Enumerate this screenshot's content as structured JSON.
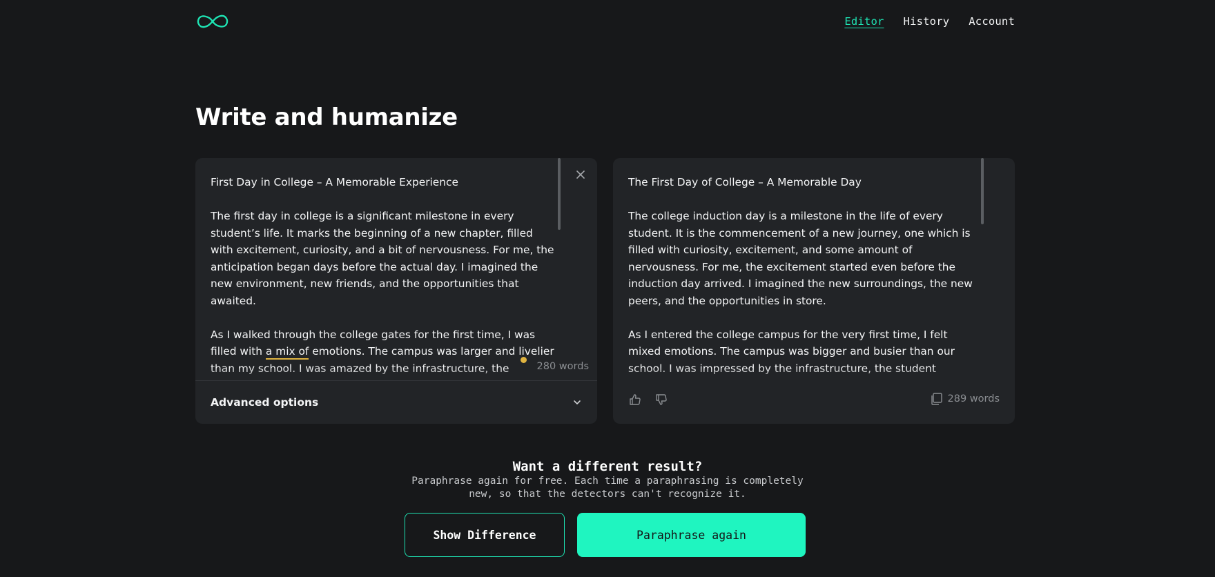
{
  "header": {
    "logo_icon": "infinity-logo-icon",
    "nav": [
      {
        "label": "Editor",
        "active": true
      },
      {
        "label": "History",
        "active": false
      },
      {
        "label": "Account",
        "active": false
      }
    ]
  },
  "page_title": "Write and humanize",
  "input_panel": {
    "heading": "First Day in College – A Memorable Experience",
    "paragraph1": "The first day in college is a significant milestone in every student’s life. It marks the beginning of a new chapter, filled with excitement, curiosity, and a bit of nervousness. For me, the anticipation began days before the actual day. I imagined the new environment, new friends, and the opportunities that awaited.",
    "paragraph2_before": "As I walked through the college gates for the first time, I was filled with ",
    "paragraph2_highlight": "a mix of",
    "paragraph2_after": " emotions. The campus was larger and livelier than my school. I was amazed by the infrastructure, the",
    "word_count": "280 words",
    "advanced_label": "Advanced options"
  },
  "output_panel": {
    "heading": "The First Day of College – A Memorable Day",
    "paragraph1": "The college induction day is a milestone in the life of every student. It is the commencement of a new journey, one which is filled with curiosity, excitement, and some amount of nervousness. For me, the excitement started even before the induction day arrived. I imagined the new surroundings, the new peers, and the opportunities in store.",
    "paragraph2": "As I entered the college campus for the very first time, I felt mixed emotions. The campus was bigger and busier than our school. I was impressed by the infrastructure, the student",
    "word_count": "289 words"
  },
  "cta": {
    "title": "Want a different result?",
    "subtitle": "Paraphrase again for free. Each time a paraphrasing is completely new, so that the detectors can't recognize it.",
    "show_difference": "Show Difference",
    "paraphrase_again": "Paraphrase again"
  },
  "colors": {
    "accent": "#1ee3b3",
    "primary_button": "#1ff5c0",
    "background": "#17181a",
    "panel": "#222427",
    "highlight": "#e0b440"
  }
}
